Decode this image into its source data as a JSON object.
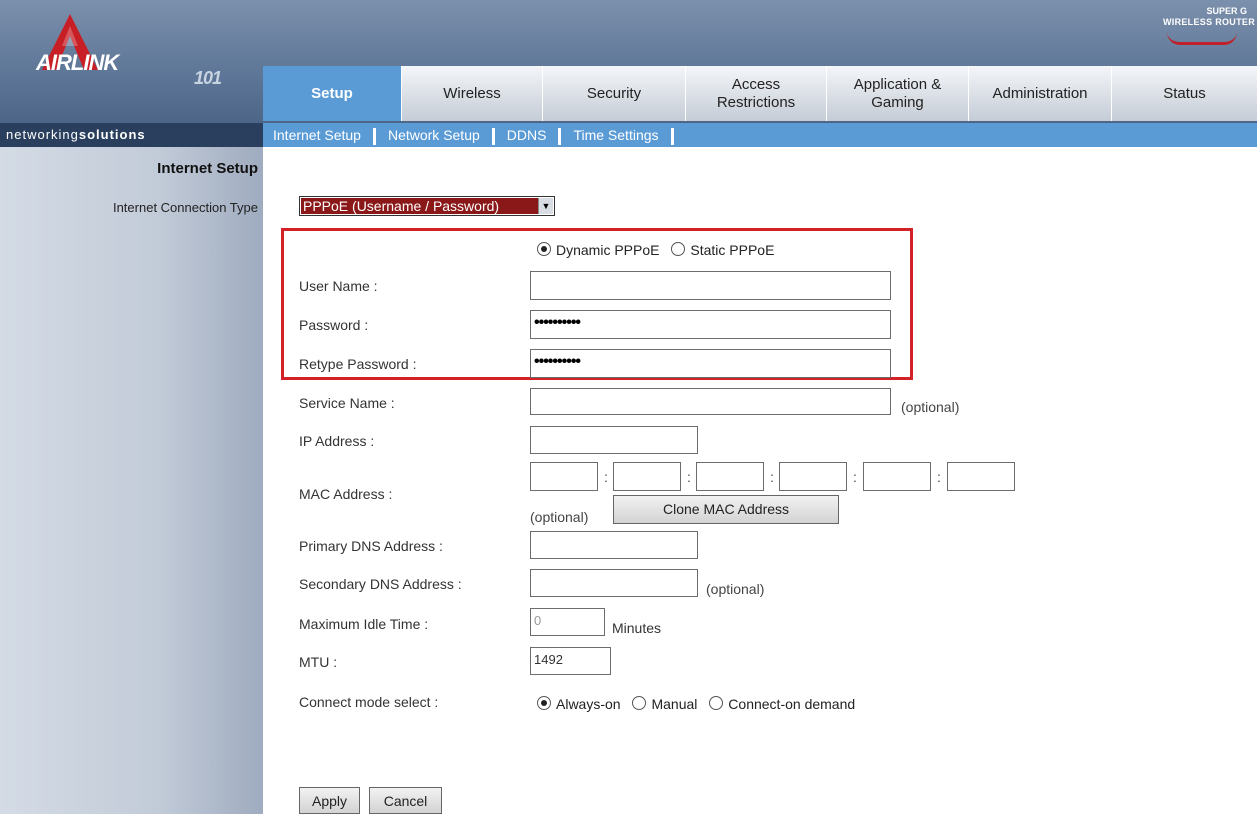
{
  "brand": {
    "logo_text": "AIRLINK",
    "logo_num": "101",
    "tagline_light": "networking",
    "tagline_bold": "solutions",
    "badge_line1": "SUPER G",
    "badge_line2": "WIRELESS ROUTER"
  },
  "tabs": [
    {
      "label": "Setup",
      "active": true
    },
    {
      "label": "Wireless"
    },
    {
      "label": "Security"
    },
    {
      "label": "Access Restrictions"
    },
    {
      "label": "Application & Gaming"
    },
    {
      "label": "Administration"
    },
    {
      "label": "Status"
    }
  ],
  "subnav": [
    "Internet Setup",
    "Network Setup",
    "DDNS",
    "Time Settings"
  ],
  "section_title": "Internet Setup",
  "conn_type": {
    "label": "Internet Connection Type",
    "value": "PPPoE (Username / Password)"
  },
  "pppoe_mode": {
    "options": [
      "Dynamic PPPoE",
      "Static PPPoE"
    ],
    "selected": "Dynamic PPPoE"
  },
  "fields": {
    "username": {
      "label": "User Name :",
      "value": ""
    },
    "password": {
      "label": "Password :",
      "value": "••••••••••"
    },
    "retype": {
      "label": "Retype Password :",
      "value": "••••••••••"
    },
    "service": {
      "label": "Service Name :",
      "value": "",
      "hint": "(optional)"
    },
    "ip": {
      "label": "IP Address :",
      "value": ""
    },
    "mac": {
      "label": "MAC Address :",
      "octets": [
        "",
        "",
        "",
        "",
        "",
        ""
      ],
      "hint": "(optional)",
      "separator": ":"
    },
    "dns1": {
      "label": "Primary DNS Address :",
      "value": ""
    },
    "dns2": {
      "label": "Secondary DNS Address :",
      "value": "",
      "hint": "(optional)"
    },
    "idle": {
      "label": "Maximum Idle Time :",
      "value": "0",
      "unit": "Minutes"
    },
    "mtu": {
      "label": "MTU :",
      "value": "1492"
    }
  },
  "clone_button": "Clone MAC Address",
  "connect_mode": {
    "label": "Connect mode select :",
    "options": [
      "Always-on",
      "Manual",
      "Connect-on demand"
    ],
    "selected": "Always-on"
  },
  "buttons": {
    "apply": "Apply",
    "cancel": "Cancel"
  },
  "colors": {
    "nav_blue": "#5a9bd6",
    "highlight_red": "#d22227",
    "select_bg": "#8a1818"
  }
}
